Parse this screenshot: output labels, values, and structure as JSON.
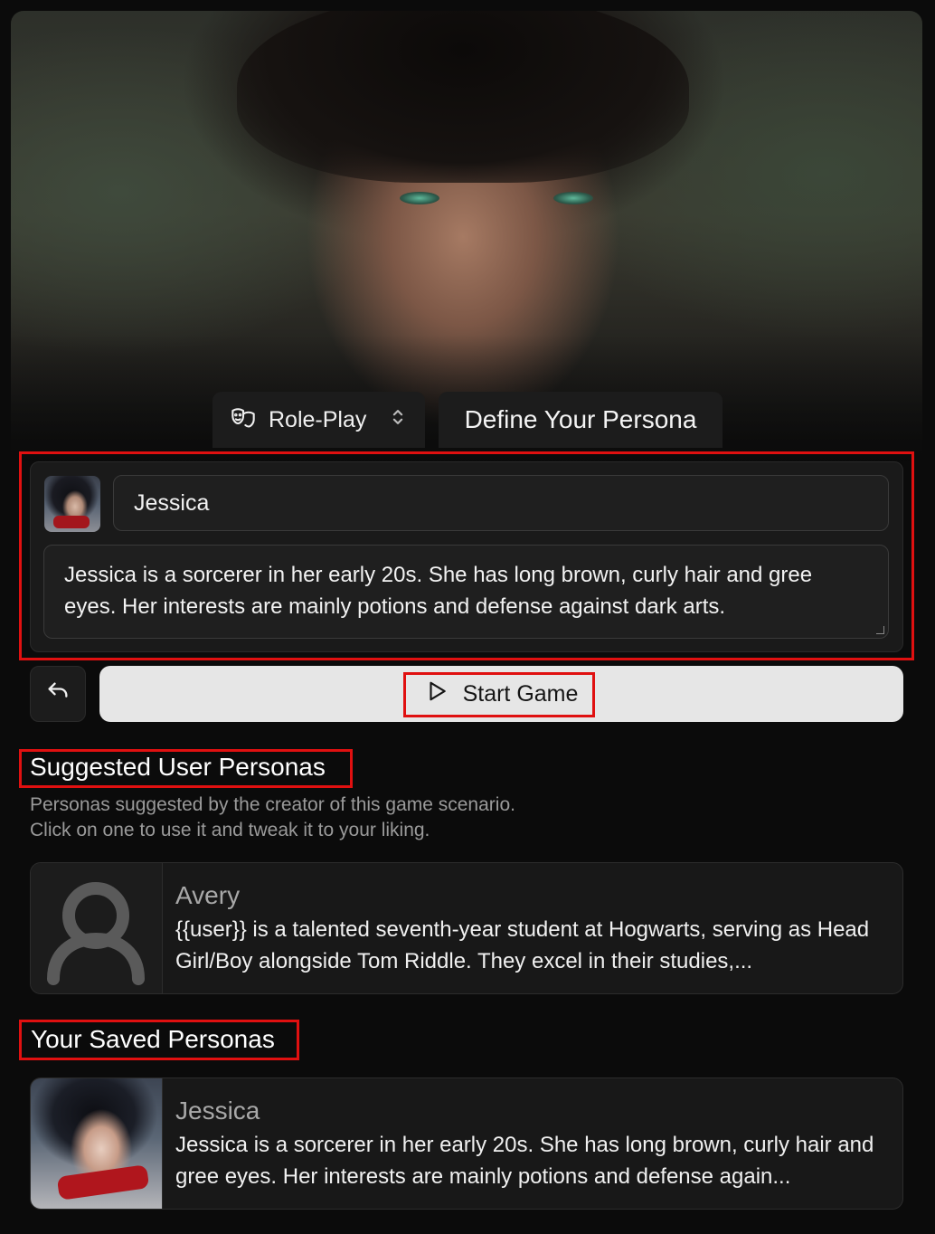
{
  "header": {
    "mode_label": "Role-Play",
    "title": "Define Your Persona"
  },
  "editor": {
    "name_value": "Jessica",
    "description_value": "Jessica is a sorcerer in her early 20s. She has long brown, curly hair and gree eyes. Her interests are mainly potions and defense against dark arts."
  },
  "actions": {
    "start_label": "Start Game"
  },
  "suggested": {
    "title": "Suggested User Personas",
    "subtitle_line1": "Personas suggested by the creator of this game scenario.",
    "subtitle_line2": "Click on one to use it and tweak it to your liking.",
    "items": [
      {
        "name": "Avery",
        "description": "{{user}} is a talented seventh-year student at Hogwarts, serving as Head Girl/Boy alongside Tom Riddle. They excel in their studies,..."
      }
    ]
  },
  "saved": {
    "title": "Your Saved Personas",
    "items": [
      {
        "name": "Jessica",
        "description": "Jessica is a sorcerer in her early 20s. She has long brown, curly hair and gree eyes. Her interests are mainly potions and defense again..."
      }
    ]
  },
  "icons": {
    "mode": "theater-masks-icon",
    "mode_toggle": "chevron-up-down-icon",
    "undo": "undo-icon",
    "start": "play-icon",
    "placeholder_avatar": "user-silhouette-icon"
  },
  "colors": {
    "background": "#0b0b0b",
    "panel": "#1a1a1a",
    "start_button": "#e6e6e6",
    "highlight": "#e01010"
  }
}
